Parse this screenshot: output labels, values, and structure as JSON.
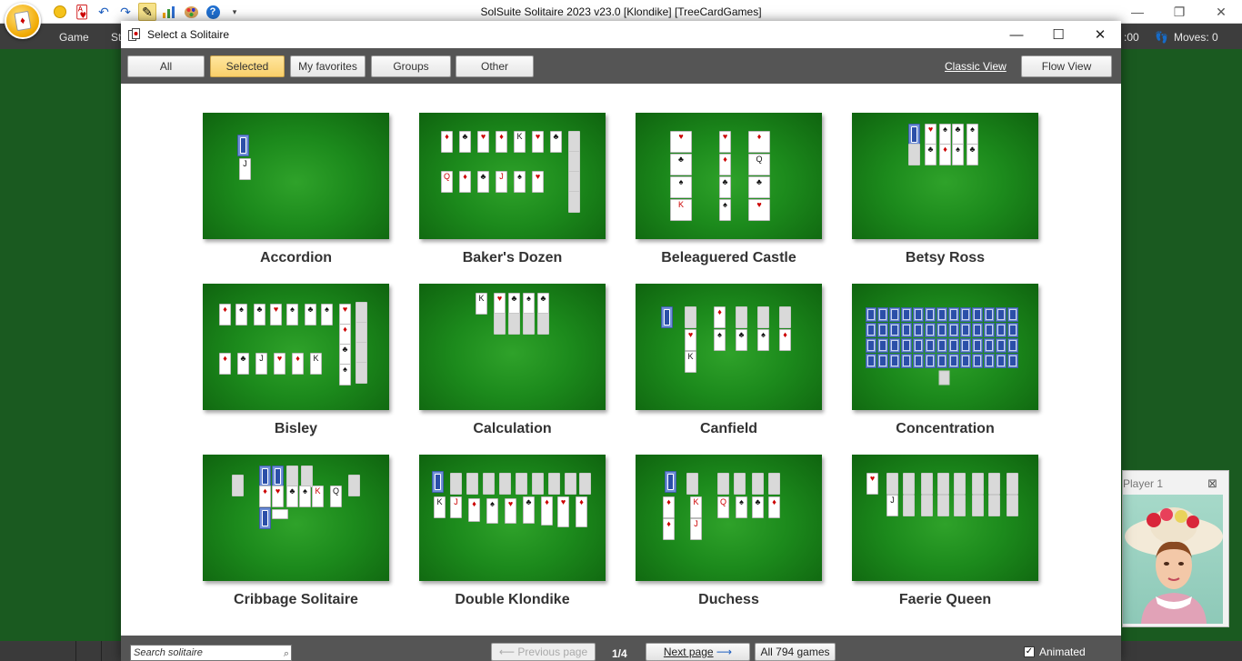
{
  "app": {
    "title": "SolSuite Solitaire 2023 v23.0  [Klondike]  [TreeCardGames]",
    "menu": [
      "Game",
      "St"
    ],
    "timer_fragment": ":00",
    "moves_label": "Moves: 0",
    "player_name": "Player 1"
  },
  "dialog": {
    "title": "Select a Solitaire",
    "filters": [
      "All",
      "Selected",
      "My favorites",
      "Groups",
      "Other"
    ],
    "selected_filter": "Selected",
    "classic_view": "Classic View",
    "flow_view": "Flow View"
  },
  "games": [
    "Accordion",
    "Baker's Dozen",
    "Beleaguered Castle",
    "Betsy Ross",
    "Bisley",
    "Calculation",
    "Canfield",
    "Concentration",
    "Cribbage Solitaire",
    "Double Klondike",
    "Duchess",
    "Faerie Queen"
  ],
  "footer": {
    "search_placeholder": "Search solitaire",
    "prev": "Previous page",
    "page": "1/4",
    "next": "Next page",
    "all_games": "All 794 games",
    "animated": "Animated"
  },
  "colors": {
    "felt": "#1c8a1c",
    "bar": "#555555",
    "selected_filter": "#f9cf6a"
  }
}
